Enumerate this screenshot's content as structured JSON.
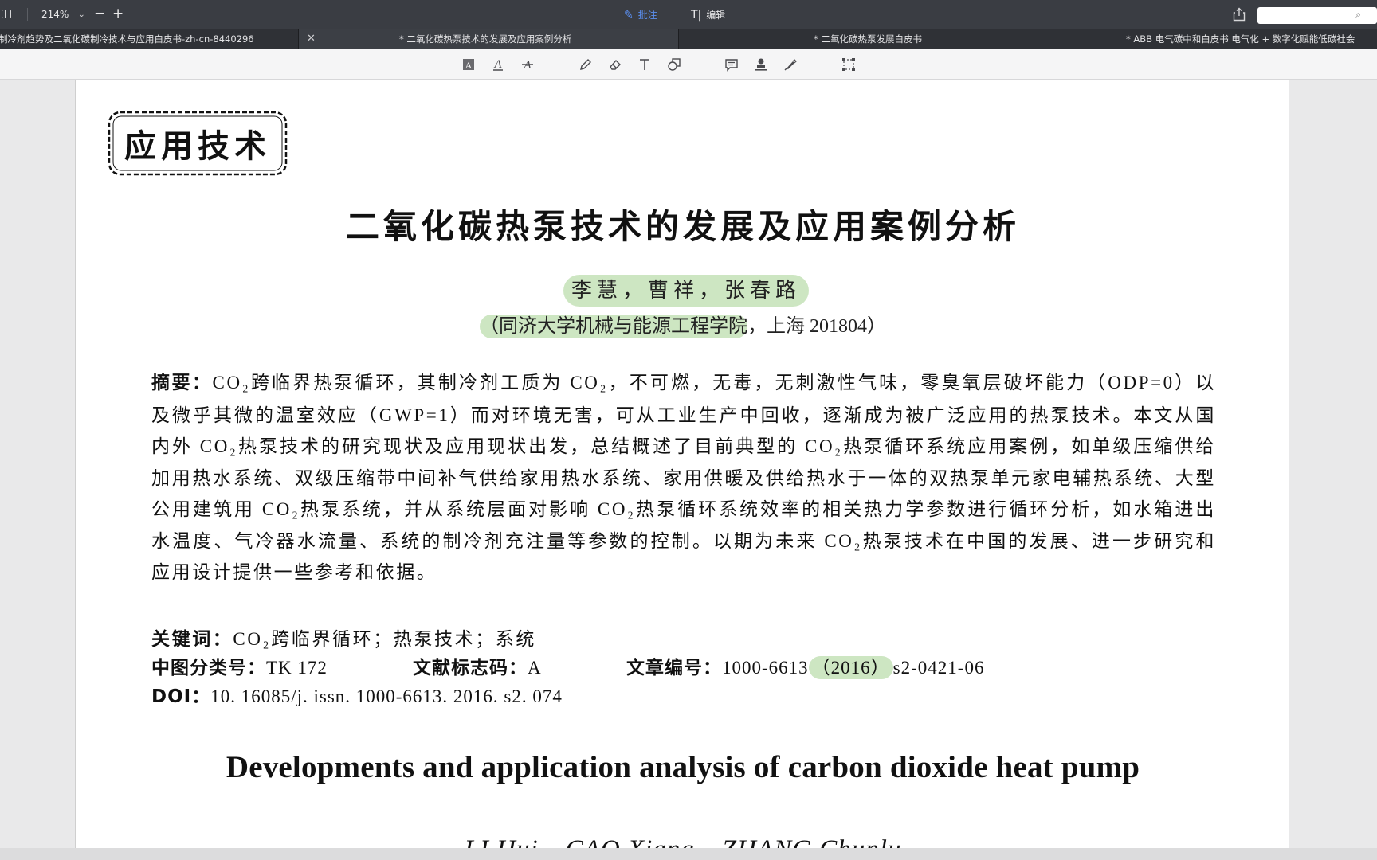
{
  "toolbar": {
    "zoom_level": "214%",
    "zoom_out_symbol": "−",
    "zoom_in_symbol": "+",
    "annotate_label": "批注",
    "edit_label": "编辑",
    "search_placeholder": ""
  },
  "tabs": [
    {
      "label": "制冷剂趋势及二氧化碳制冷技术与应用白皮书-zh-cn-8440296",
      "active": false
    },
    {
      "label": "* 二氧化碳热泵技术的发展及应用案例分析",
      "active": true,
      "close_symbol": "✕"
    },
    {
      "label": "* 二氧化碳热泵发展白皮书",
      "active": false
    },
    {
      "label": "* ABB 电气碳中和白皮书 电气化 + 数字化赋能低碳社会",
      "active": false
    }
  ],
  "annotation_tools": [
    {
      "name": "text-highlight-tool-icon",
      "glyph": "A"
    },
    {
      "name": "text-underline-tool-icon",
      "glyph": "A"
    },
    {
      "name": "text-strikethrough-tool-icon",
      "glyph": "A"
    },
    {
      "name": "pencil-tool-icon",
      "glyph": "✎"
    },
    {
      "name": "eraser-tool-icon",
      "glyph": "⌫"
    },
    {
      "name": "text-box-tool-icon",
      "glyph": "T"
    },
    {
      "name": "shape-tool-icon",
      "glyph": "◰"
    },
    {
      "name": "note-tool-icon",
      "glyph": "▤"
    },
    {
      "name": "stamp-tool-icon",
      "glyph": "⚲"
    },
    {
      "name": "signature-tool-icon",
      "glyph": "✒"
    },
    {
      "name": "area-select-tool-icon",
      "glyph": "⬚"
    }
  ],
  "document": {
    "section_stamp": "应用技术",
    "title_cn": "二氧化碳热泵技术的发展及应用案例分析",
    "authors_cn": "李慧，曹祥，张春路",
    "affiliation_highlighted": "（同济大学机械与能源工程学院",
    "affiliation_rest": "，上海 201804）",
    "abstract_label": "摘要：",
    "abstract_text": "CO₂跨临界热泵循环，其制冷剂工质为 CO₂，不可燃，无毒，无刺激性气味，零臭氧层破坏能力（ODP=0）以及微乎其微的温室效应（GWP=1）而对环境无害，可从工业生产中回收，逐渐成为被广泛应用的热泵技术。本文从国内外 CO₂热泵技术的研究现状及应用现状出发，总结概述了目前典型的 CO₂热泵循环系统应用案例，如单级压缩供给加用热水系统、双级压缩带中间补气供给家用热水系统、家用供暖及供给热水于一体的双热泵单元家电辅热系统、大型公用建筑用 CO₂热泵系统，并从系统层面对影响 CO₂热泵循环系统效率的相关热力学参数进行循环分析，如水箱进出水温度、气冷器水流量、系统的制冷剂充注量等参数的控制。以期为未来 CO₂热泵技术在中国的发展、进一步研究和应用设计提供一些参考和依据。",
    "keywords_label": "关键词：",
    "keywords_text": "CO₂跨临界循环；热泵技术；系统",
    "clc_label": "中图分类号：",
    "clc_value": "TK 172",
    "doc_code_label": "文献标志码：",
    "doc_code_value": "A",
    "article_no_label": "文章编号：",
    "article_no_prefix": "1000-6613",
    "article_no_year": "（2016）",
    "article_no_suffix": "s2-0421-06",
    "doi_label": "DOI：",
    "doi_value": "10. 16085/j. issn. 1000-6613. 2016. s2. 074",
    "title_en": "Developments and application analysis of carbon dioxide heat pump",
    "authors_en": "LI Hui，CAO Xiang，ZHANG Chunlu"
  },
  "colors": {
    "toolbar_bg": "#3a3d43",
    "tabbar_bg": "#2f3136",
    "accent_blue": "#5b8ff0",
    "highlight_green": "#90c878"
  }
}
